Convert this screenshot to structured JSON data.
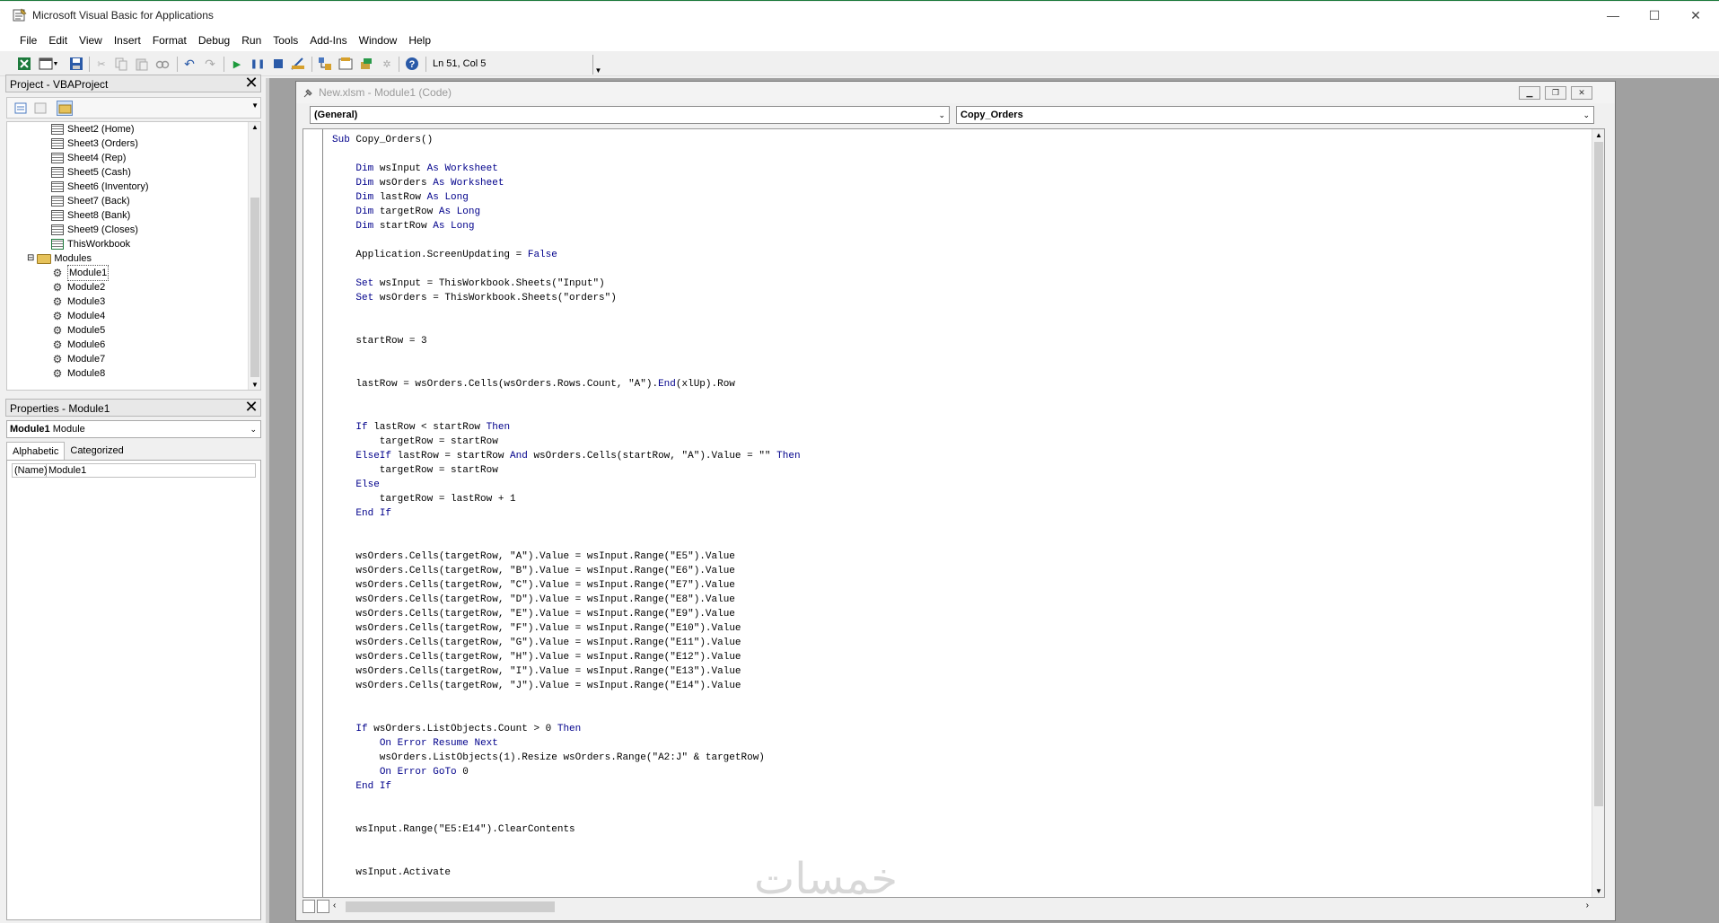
{
  "window": {
    "title": "Microsoft Visual Basic for Applications",
    "controls": {
      "minimize": "—",
      "maximize": "☐",
      "close": "✕"
    }
  },
  "menu": [
    "File",
    "Edit",
    "View",
    "Insert",
    "Format",
    "Debug",
    "Run",
    "Tools",
    "Add-Ins",
    "Window",
    "Help"
  ],
  "toolbar": {
    "icons": [
      "excel-icon",
      "insert-module-icon",
      "save-icon",
      "cut-icon",
      "copy-icon",
      "paste-icon",
      "find-icon",
      "undo-icon",
      "redo-icon",
      "run-icon",
      "break-icon",
      "reset-icon",
      "design-mode-icon",
      "project-explorer-icon",
      "properties-icon",
      "object-browser-icon",
      "toolbox-icon",
      "help-icon"
    ],
    "position_label": "Ln 51, Col 5"
  },
  "project": {
    "title": "Project - VBAProject",
    "tree": [
      {
        "label": "Sheet2 (Home)",
        "type": "sheet"
      },
      {
        "label": "Sheet3 (Orders)",
        "type": "sheet"
      },
      {
        "label": "Sheet4 (Rep)",
        "type": "sheet"
      },
      {
        "label": "Sheet5 (Cash)",
        "type": "sheet"
      },
      {
        "label": "Sheet6 (Inventory)",
        "type": "sheet"
      },
      {
        "label": "Sheet7 (Back)",
        "type": "sheet"
      },
      {
        "label": "Sheet8 (Bank)",
        "type": "sheet"
      },
      {
        "label": "Sheet9 (Closes)",
        "type": "sheet"
      },
      {
        "label": "ThisWorkbook",
        "type": "workbook"
      },
      {
        "label": "Modules",
        "type": "folder"
      },
      {
        "label": "Module1",
        "type": "module"
      },
      {
        "label": "Module2",
        "type": "module"
      },
      {
        "label": "Module3",
        "type": "module"
      },
      {
        "label": "Module4",
        "type": "module"
      },
      {
        "label": "Module5",
        "type": "module"
      },
      {
        "label": "Module6",
        "type": "module"
      },
      {
        "label": "Module7",
        "type": "module"
      },
      {
        "label": "Module8",
        "type": "module"
      }
    ]
  },
  "properties": {
    "title": "Properties - Module1",
    "object_name": "Module1",
    "object_type": "Module",
    "tabs": [
      "Alphabetic",
      "Categorized"
    ],
    "rows": [
      {
        "key": "(Name)",
        "value": "Module1"
      }
    ]
  },
  "code_window": {
    "title": "New.xlsm - Module1 (Code)",
    "object_combo": "(General)",
    "procedure_combo": "Copy_Orders",
    "lines": [
      "Sub Copy_Orders()",
      "",
      "    Dim wsInput As Worksheet",
      "    Dim wsOrders As Worksheet",
      "    Dim lastRow As Long",
      "    Dim targetRow As Long",
      "    Dim startRow As Long",
      "",
      "    Application.ScreenUpdating = False",
      "",
      "    Set wsInput = ThisWorkbook.Sheets(\"Input\")",
      "    Set wsOrders = ThisWorkbook.Sheets(\"orders\")",
      "",
      "",
      "    startRow = 3",
      "",
      "",
      "    lastRow = wsOrders.Cells(wsOrders.Rows.Count, \"A\").End(xlUp).Row",
      "",
      "",
      "    If lastRow < startRow Then",
      "        targetRow = startRow",
      "    ElseIf lastRow = startRow And wsOrders.Cells(startRow, \"A\").Value = \"\" Then",
      "        targetRow = startRow",
      "    Else",
      "        targetRow = lastRow + 1",
      "    End If",
      "",
      "",
      "    wsOrders.Cells(targetRow, \"A\").Value = wsInput.Range(\"E5\").Value",
      "    wsOrders.Cells(targetRow, \"B\").Value = wsInput.Range(\"E6\").Value",
      "    wsOrders.Cells(targetRow, \"C\").Value = wsInput.Range(\"E7\").Value",
      "    wsOrders.Cells(targetRow, \"D\").Value = wsInput.Range(\"E8\").Value",
      "    wsOrders.Cells(targetRow, \"E\").Value = wsInput.Range(\"E9\").Value",
      "    wsOrders.Cells(targetRow, \"F\").Value = wsInput.Range(\"E10\").Value",
      "    wsOrders.Cells(targetRow, \"G\").Value = wsInput.Range(\"E11\").Value",
      "    wsOrders.Cells(targetRow, \"H\").Value = wsInput.Range(\"E12\").Value",
      "    wsOrders.Cells(targetRow, \"I\").Value = wsInput.Range(\"E13\").Value",
      "    wsOrders.Cells(targetRow, \"J\").Value = wsInput.Range(\"E14\").Value",
      "",
      "",
      "    If wsOrders.ListObjects.Count > 0 Then",
      "        On Error Resume Next",
      "        wsOrders.ListObjects(1).Resize wsOrders.Range(\"A2:J\" & targetRow)",
      "        On Error GoTo 0",
      "    End If",
      "",
      "",
      "    wsInput.Range(\"E5:E14\").ClearContents",
      "",
      "",
      "    wsInput.Activate"
    ]
  },
  "watermark": "خمسات",
  "colors": {
    "keyword": "#00008b",
    "accent_green": "#1d7a3c"
  }
}
